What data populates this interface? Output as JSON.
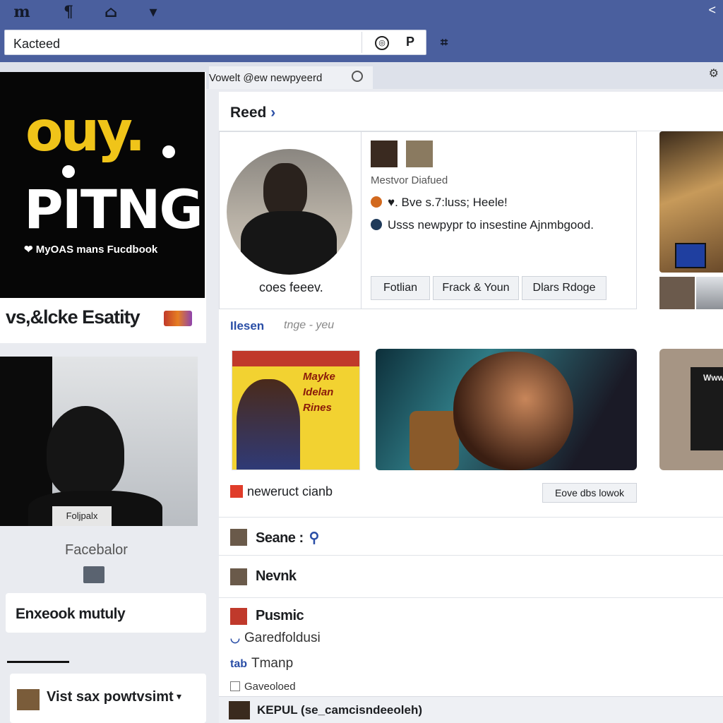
{
  "topbar": {
    "icons": [
      "m-icon",
      "bookmark-icon",
      "home-icon",
      "profile-icon"
    ],
    "icon_glyphs": [
      "m",
      "¶",
      "⌂",
      "▾"
    ],
    "collapse": "<",
    "search_value": "Kacteed",
    "search_icon_glyph": "◎",
    "pin_glyph": "P",
    "extra_glyph": "⌗"
  },
  "strip": {
    "search_text": "Vowelt @ew newpyeerd",
    "right_glyph": "⚙"
  },
  "left": {
    "promo": {
      "line1": "ouy.",
      "line2": "PITNG",
      "small": "❤ MyOAS mans Fucdbook"
    },
    "caption": "vs,&lcke Esatity",
    "photo_tag": "Foljpalx",
    "brand": "Facebalor",
    "box_text": "Enxeook mutuly",
    "bottom_text": "Vist sax powtvsimt",
    "bottom_chevron": "▾"
  },
  "main": {
    "feed_title": "Reed",
    "feed_chevron": "›",
    "profile": {
      "name": "coes feeev.",
      "meta": "Mestvor Diafued",
      "line1": "♥. Bve s.7:luss; Heele!",
      "line2": "Usss newpypr to insestine  Ajnmbgood.",
      "buttons": [
        "Fotlian",
        "Frack & Youn",
        "Dlars Rdoge"
      ]
    },
    "section_title": "Ilesen",
    "section_sub": "tnge - yeu",
    "media1_text": "Mayke\nIdelan\nRines",
    "media3_text": "Www",
    "post_text": "neweruct cianb",
    "post_button": "Eove dbs lowok",
    "rows": [
      {
        "label": "Seane :",
        "extra": "⚲"
      },
      {
        "label": "Nevnk",
        "extra": ""
      },
      {
        "label": "Pusmic",
        "extra": ""
      }
    ],
    "plain1": "Garedfoldusi",
    "plain1_prefix": "◡",
    "plain2_prefix": "tab",
    "plain2": "Tmanp",
    "small_line": "Gaveoloed",
    "bottom_row": "KEPUL (se_camcisndeeoleh)"
  }
}
